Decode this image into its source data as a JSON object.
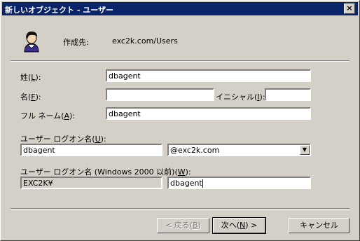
{
  "window": {
    "title": "新しいオブジェクト - ユーザー",
    "close_label": "×"
  },
  "header": {
    "created_in_label": "作成先:",
    "created_in_value": "exc2k.com/Users"
  },
  "form": {
    "last_name_label": "姓(L):",
    "last_name_value": "dbagent",
    "first_name_label": "名(F):",
    "first_name_value": "",
    "initials_label": "イニシャル(I):",
    "initials_value": "",
    "full_name_label": "フル ネーム(A):",
    "full_name_value": "dbagent",
    "logon_name_label": "ユーザー ログオン名(U):",
    "logon_name_value": "dbagent",
    "domain_suffix_value": "@exc2k.com",
    "pre2000_label": "ユーザー ログオン名 (Windows 2000 以前)(W):",
    "pre2000_domain_value": "EXC2K¥",
    "pre2000_name_value": "dbagent"
  },
  "buttons": {
    "back_label": "< 戻る(B)",
    "next_label": "次へ(N) >",
    "cancel_label": "キャンセル"
  },
  "icons": {
    "user": "user-icon",
    "close": "close-icon",
    "dropdown": "chevron-down-icon"
  },
  "colors": {
    "titlebar": "#0a246a",
    "face": "#d4d0c8"
  }
}
